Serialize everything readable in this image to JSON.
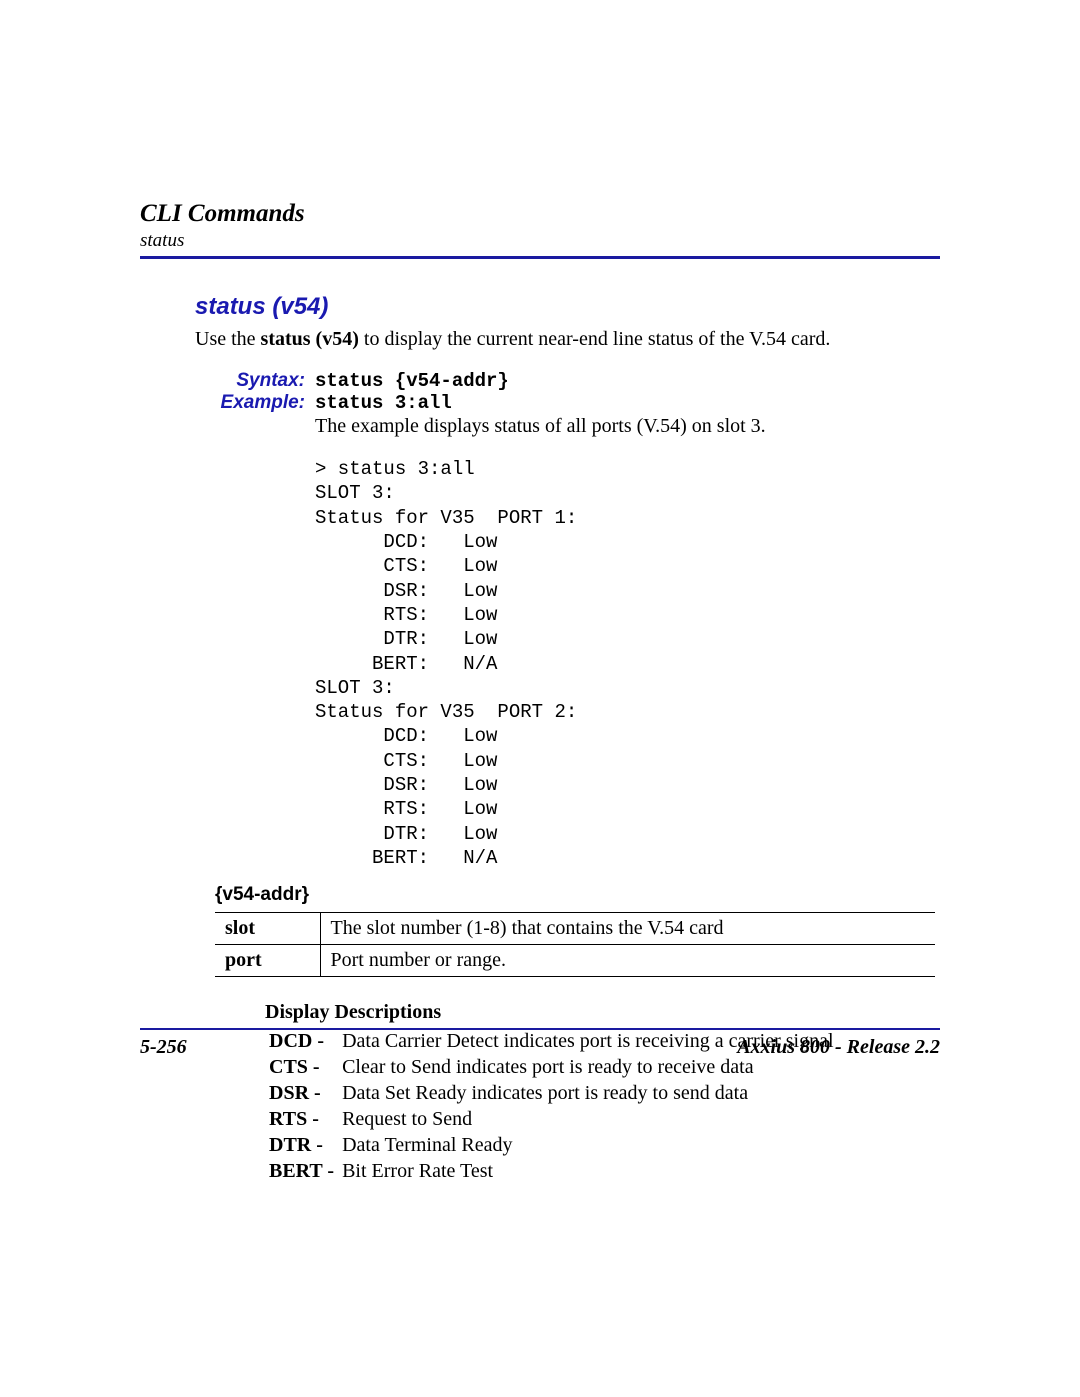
{
  "header": {
    "chapter": "CLI Commands",
    "sub": "status"
  },
  "command": {
    "title": "status (v54)",
    "intro_pre": "Use the ",
    "intro_bold": "status (v54)",
    "intro_post": " to display the current near-end line status of the V.54 card."
  },
  "syntax": {
    "label": "Syntax:",
    "value": "status {v54-addr}"
  },
  "example": {
    "label": "Example:",
    "value": "status 3:all",
    "desc": "The example displays status of all ports (V.54) on slot 3."
  },
  "terminal_output": "> status 3:all\nSLOT 3:\nStatus for V35  PORT 1:\n      DCD:   Low\n      CTS:   Low\n      DSR:   Low\n      RTS:   Low\n      DTR:   Low\n     BERT:   N/A\nSLOT 3:\nStatus for V35  PORT 2:\n      DCD:   Low\n      CTS:   Low\n      DSR:   Low\n      RTS:   Low\n      DTR:   Low\n     BERT:   N/A",
  "param_section": {
    "heading": "{v54-addr}",
    "rows": [
      {
        "key": "slot",
        "desc": "The slot number (1-8) that contains the V.54 card"
      },
      {
        "key": "port",
        "desc": "Port number or range."
      }
    ]
  },
  "display_desc": {
    "heading": "Display Descriptions",
    "items": [
      {
        "abbr": "DCD",
        "desc": "Data Carrier Detect indicates port is receiving a carrier signal"
      },
      {
        "abbr": "CTS",
        "desc": "Clear to Send indicates port is ready to receive data"
      },
      {
        "abbr": "DSR",
        "desc": "Data Set Ready indicates port is ready to send data"
      },
      {
        "abbr": "RTS",
        "desc": "Request to Send"
      },
      {
        "abbr": "DTR",
        "desc": "Data Terminal Ready"
      },
      {
        "abbr": "BERT",
        "desc": "Bit Error Rate Test"
      }
    ]
  },
  "footer": {
    "left": "5-256",
    "right": "Axxius 800 - Release 2.2"
  }
}
